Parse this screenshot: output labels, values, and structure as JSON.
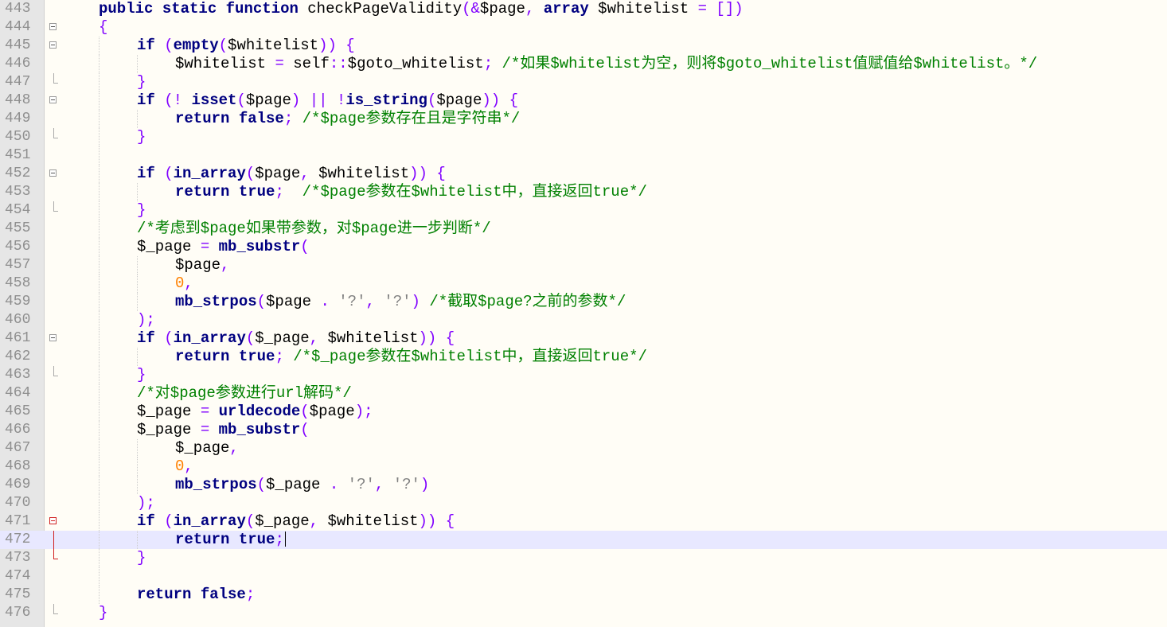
{
  "editor": {
    "current_line": 472,
    "lines": [
      {
        "n": "443",
        "indent": 1,
        "fold": "",
        "tokens": [
          [
            "kw",
            "public"
          ],
          [
            "txt",
            " "
          ],
          [
            "kw",
            "static"
          ],
          [
            "txt",
            " "
          ],
          [
            "kw",
            "function"
          ],
          [
            "txt",
            " checkPageValidity"
          ],
          [
            "op",
            "(&"
          ],
          [
            "var",
            "$page"
          ],
          [
            "op",
            ","
          ],
          [
            "txt",
            " "
          ],
          [
            "kw",
            "array"
          ],
          [
            "txt",
            " "
          ],
          [
            "var",
            "$whitelist"
          ],
          [
            "txt",
            " "
          ],
          [
            "op",
            "= [])"
          ]
        ]
      },
      {
        "n": "444",
        "indent": 1,
        "fold": "box",
        "tokens": [
          [
            "op",
            "{"
          ]
        ]
      },
      {
        "n": "445",
        "indent": 2,
        "fold": "box",
        "tokens": [
          [
            "kw",
            "if"
          ],
          [
            "txt",
            " "
          ],
          [
            "op",
            "("
          ],
          [
            "fn",
            "empty"
          ],
          [
            "op",
            "("
          ],
          [
            "var",
            "$whitelist"
          ],
          [
            "op",
            "))"
          ],
          [
            "txt",
            " "
          ],
          [
            "op",
            "{"
          ]
        ]
      },
      {
        "n": "446",
        "indent": 3,
        "fold": "line",
        "tokens": [
          [
            "var",
            "$whitelist"
          ],
          [
            "txt",
            " "
          ],
          [
            "op",
            "="
          ],
          [
            "txt",
            " self"
          ],
          [
            "op",
            "::"
          ],
          [
            "var",
            "$goto_whitelist"
          ],
          [
            "op",
            ";"
          ],
          [
            "txt",
            " "
          ],
          [
            "cm",
            "/*如果$whitelist为空，则将$goto_whitelist值赋值给$whitelist。*/"
          ]
        ]
      },
      {
        "n": "447",
        "indent": 2,
        "fold": "end",
        "tokens": [
          [
            "op",
            "}"
          ]
        ]
      },
      {
        "n": "448",
        "indent": 2,
        "fold": "box",
        "tokens": [
          [
            "kw",
            "if"
          ],
          [
            "txt",
            " "
          ],
          [
            "op",
            "(!"
          ],
          [
            "txt",
            " "
          ],
          [
            "fn",
            "isset"
          ],
          [
            "op",
            "("
          ],
          [
            "var",
            "$page"
          ],
          [
            "op",
            ")"
          ],
          [
            "txt",
            " "
          ],
          [
            "op",
            "||"
          ],
          [
            "txt",
            " "
          ],
          [
            "op",
            "!"
          ],
          [
            "fn",
            "is_string"
          ],
          [
            "op",
            "("
          ],
          [
            "var",
            "$page"
          ],
          [
            "op",
            "))"
          ],
          [
            "txt",
            " "
          ],
          [
            "op",
            "{"
          ]
        ]
      },
      {
        "n": "449",
        "indent": 3,
        "fold": "line",
        "tokens": [
          [
            "kw",
            "return"
          ],
          [
            "txt",
            " "
          ],
          [
            "kw",
            "false"
          ],
          [
            "op",
            ";"
          ],
          [
            "txt",
            " "
          ],
          [
            "cm",
            "/*$page参数存在且是字符串*/"
          ]
        ]
      },
      {
        "n": "450",
        "indent": 2,
        "fold": "end",
        "tokens": [
          [
            "op",
            "}"
          ]
        ]
      },
      {
        "n": "451",
        "indent": 2,
        "fold": "line",
        "tokens": []
      },
      {
        "n": "452",
        "indent": 2,
        "fold": "box",
        "tokens": [
          [
            "kw",
            "if"
          ],
          [
            "txt",
            " "
          ],
          [
            "op",
            "("
          ],
          [
            "fn",
            "in_array"
          ],
          [
            "op",
            "("
          ],
          [
            "var",
            "$page"
          ],
          [
            "op",
            ","
          ],
          [
            "txt",
            " "
          ],
          [
            "var",
            "$whitelist"
          ],
          [
            "op",
            "))"
          ],
          [
            "txt",
            " "
          ],
          [
            "op",
            "{"
          ]
        ]
      },
      {
        "n": "453",
        "indent": 3,
        "fold": "line",
        "tokens": [
          [
            "kw",
            "return"
          ],
          [
            "txt",
            " "
          ],
          [
            "kw",
            "true"
          ],
          [
            "op",
            ";"
          ],
          [
            "txt",
            "  "
          ],
          [
            "cm",
            "/*$page参数在$whitelist中，直接返回true*/"
          ]
        ]
      },
      {
        "n": "454",
        "indent": 2,
        "fold": "end",
        "tokens": [
          [
            "op",
            "}"
          ]
        ]
      },
      {
        "n": "455",
        "indent": 2,
        "fold": "line",
        "tokens": [
          [
            "cm",
            "/*考虑到$page如果带参数，对$page进一步判断*/"
          ]
        ]
      },
      {
        "n": "456",
        "indent": 2,
        "fold": "line",
        "tokens": [
          [
            "var",
            "$_page"
          ],
          [
            "txt",
            " "
          ],
          [
            "op",
            "="
          ],
          [
            "txt",
            " "
          ],
          [
            "fn",
            "mb_substr"
          ],
          [
            "op",
            "("
          ]
        ]
      },
      {
        "n": "457",
        "indent": 3,
        "fold": "line",
        "tokens": [
          [
            "var",
            "$page"
          ],
          [
            "op",
            ","
          ]
        ]
      },
      {
        "n": "458",
        "indent": 3,
        "fold": "line",
        "tokens": [
          [
            "num",
            "0"
          ],
          [
            "op",
            ","
          ]
        ]
      },
      {
        "n": "459",
        "indent": 3,
        "fold": "line",
        "tokens": [
          [
            "fn",
            "mb_strpos"
          ],
          [
            "op",
            "("
          ],
          [
            "var",
            "$page"
          ],
          [
            "txt",
            " "
          ],
          [
            "op",
            "."
          ],
          [
            "txt",
            " "
          ],
          [
            "str",
            "'?'"
          ],
          [
            "op",
            ","
          ],
          [
            "txt",
            " "
          ],
          [
            "str",
            "'?'"
          ],
          [
            "op",
            ")"
          ],
          [
            "txt",
            " "
          ],
          [
            "cm",
            "/*截取$page?之前的参数*/"
          ]
        ]
      },
      {
        "n": "460",
        "indent": 2,
        "fold": "line",
        "tokens": [
          [
            "op",
            ");"
          ]
        ]
      },
      {
        "n": "461",
        "indent": 2,
        "fold": "box",
        "tokens": [
          [
            "kw",
            "if"
          ],
          [
            "txt",
            " "
          ],
          [
            "op",
            "("
          ],
          [
            "fn",
            "in_array"
          ],
          [
            "op",
            "("
          ],
          [
            "var",
            "$_page"
          ],
          [
            "op",
            ","
          ],
          [
            "txt",
            " "
          ],
          [
            "var",
            "$whitelist"
          ],
          [
            "op",
            "))"
          ],
          [
            "txt",
            " "
          ],
          [
            "op",
            "{"
          ]
        ]
      },
      {
        "n": "462",
        "indent": 3,
        "fold": "line",
        "tokens": [
          [
            "kw",
            "return"
          ],
          [
            "txt",
            " "
          ],
          [
            "kw",
            "true"
          ],
          [
            "op",
            ";"
          ],
          [
            "txt",
            " "
          ],
          [
            "cm",
            "/*$_page参数在$whitelist中，直接返回true*/"
          ]
        ]
      },
      {
        "n": "463",
        "indent": 2,
        "fold": "end",
        "tokens": [
          [
            "op",
            "}"
          ]
        ]
      },
      {
        "n": "464",
        "indent": 2,
        "fold": "line",
        "tokens": [
          [
            "cm",
            "/*对$page参数进行url解码*/"
          ]
        ]
      },
      {
        "n": "465",
        "indent": 2,
        "fold": "line",
        "tokens": [
          [
            "var",
            "$_page"
          ],
          [
            "txt",
            " "
          ],
          [
            "op",
            "="
          ],
          [
            "txt",
            " "
          ],
          [
            "fn",
            "urldecode"
          ],
          [
            "op",
            "("
          ],
          [
            "var",
            "$page"
          ],
          [
            "op",
            ");"
          ]
        ]
      },
      {
        "n": "466",
        "indent": 2,
        "fold": "line",
        "tokens": [
          [
            "var",
            "$_page"
          ],
          [
            "txt",
            " "
          ],
          [
            "op",
            "="
          ],
          [
            "txt",
            " "
          ],
          [
            "fn",
            "mb_substr"
          ],
          [
            "op",
            "("
          ]
        ]
      },
      {
        "n": "467",
        "indent": 3,
        "fold": "line",
        "tokens": [
          [
            "var",
            "$_page"
          ],
          [
            "op",
            ","
          ]
        ]
      },
      {
        "n": "468",
        "indent": 3,
        "fold": "line",
        "tokens": [
          [
            "num",
            "0"
          ],
          [
            "op",
            ","
          ]
        ]
      },
      {
        "n": "469",
        "indent": 3,
        "fold": "line",
        "tokens": [
          [
            "fn",
            "mb_strpos"
          ],
          [
            "op",
            "("
          ],
          [
            "var",
            "$_page"
          ],
          [
            "txt",
            " "
          ],
          [
            "op",
            "."
          ],
          [
            "txt",
            " "
          ],
          [
            "str",
            "'?'"
          ],
          [
            "op",
            ","
          ],
          [
            "txt",
            " "
          ],
          [
            "str",
            "'?'"
          ],
          [
            "op",
            ")"
          ]
        ]
      },
      {
        "n": "470",
        "indent": 2,
        "fold": "line",
        "tokens": [
          [
            "op",
            ");"
          ]
        ]
      },
      {
        "n": "471",
        "indent": 2,
        "fold": "redbox",
        "tokens": [
          [
            "kw",
            "if"
          ],
          [
            "txt",
            " "
          ],
          [
            "op",
            "("
          ],
          [
            "fn",
            "in_array"
          ],
          [
            "op",
            "("
          ],
          [
            "var",
            "$_page"
          ],
          [
            "op",
            ","
          ],
          [
            "txt",
            " "
          ],
          [
            "var",
            "$whitelist"
          ],
          [
            "op",
            "))"
          ],
          [
            "txt",
            " "
          ],
          [
            "op",
            "{"
          ]
        ]
      },
      {
        "n": "472",
        "indent": 3,
        "fold": "redline",
        "caret": true,
        "tokens": [
          [
            "kw",
            "return"
          ],
          [
            "txt",
            " "
          ],
          [
            "kw",
            "true"
          ],
          [
            "op",
            ";"
          ]
        ]
      },
      {
        "n": "473",
        "indent": 2,
        "fold": "redend",
        "tokens": [
          [
            "op",
            "}"
          ]
        ]
      },
      {
        "n": "474",
        "indent": 2,
        "fold": "line",
        "tokens": []
      },
      {
        "n": "475",
        "indent": 2,
        "fold": "line",
        "tokens": [
          [
            "kw",
            "return"
          ],
          [
            "txt",
            " "
          ],
          [
            "kw",
            "false"
          ],
          [
            "op",
            ";"
          ]
        ]
      },
      {
        "n": "476",
        "indent": 1,
        "fold": "end",
        "tokens": [
          [
            "op",
            "}"
          ]
        ]
      }
    ]
  }
}
